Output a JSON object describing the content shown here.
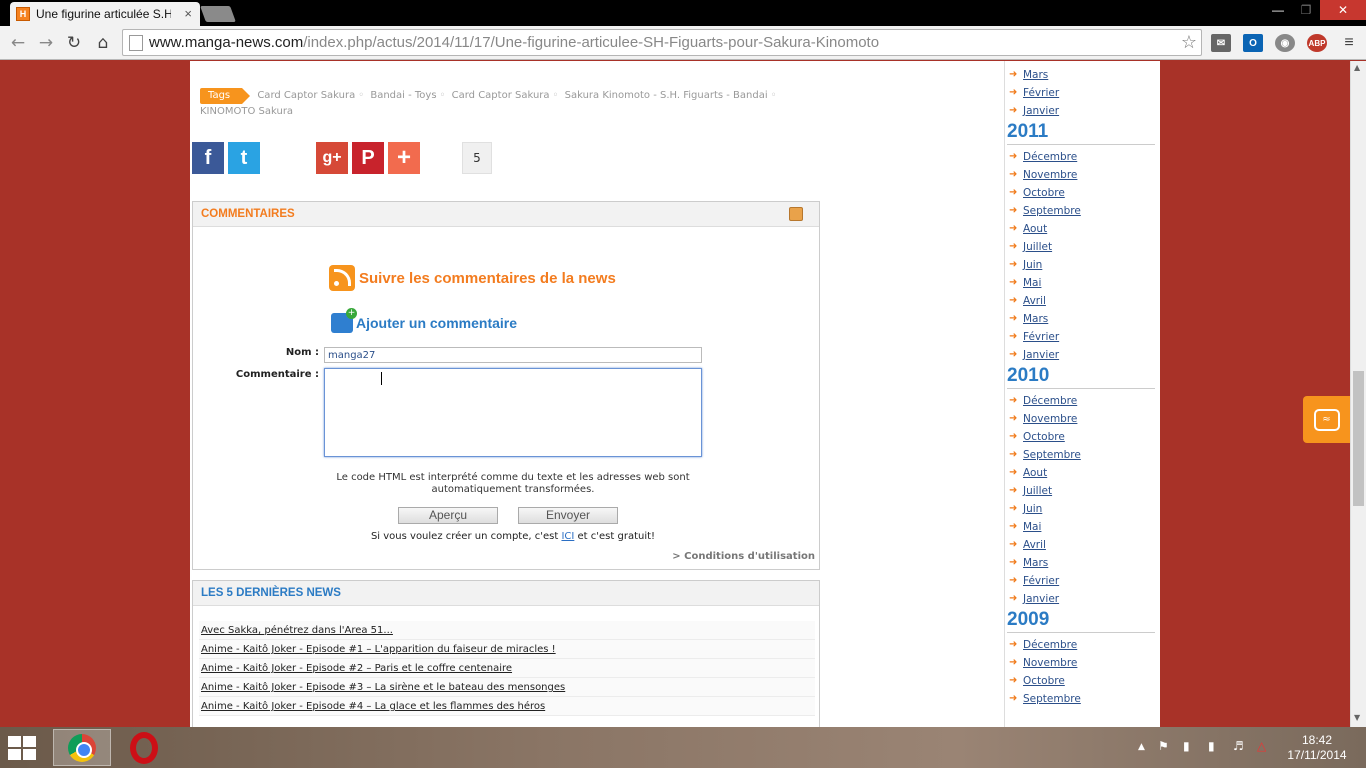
{
  "browser": {
    "tab_title": "Une figurine articulée S.H.",
    "tab_close": "×",
    "url_host": "www.manga-news.com",
    "url_path": "/index.php/actus/2014/11/17/Une-figurine-articulee-SH-Figuarts-pour-Sakura-Kinomoto",
    "favicon_letter": "H",
    "abp_badge": "ABP"
  },
  "tags": {
    "label": "Tags",
    "items": [
      "Card Captor Sakura",
      "Bandai - Toys",
      "Card Captor Sakura",
      "Sakura Kinomoto - S.H. Figuarts - Bandai",
      "KINOMOTO Sakura"
    ]
  },
  "share": {
    "facebook": "f",
    "twitter": "t",
    "count": "5",
    "googleplus": "g+",
    "pinterest": "P",
    "more": "+"
  },
  "comments": {
    "header": "COMMENTAIRES",
    "follow": "Suivre les commentaires de la news",
    "add": "Ajouter un commentaire",
    "name_label": "Nom :",
    "name_value": "manga27",
    "comment_label": "Commentaire :",
    "note": "Le code HTML est interprété comme du texte et les adresses web sont automatiquement transformées.",
    "preview_button": "Aperçu",
    "send_button": "Envoyer",
    "account_prefix": "Si vous voulez créer un compte, c'est",
    "account_link": "ICI",
    "account_suffix": "et c'est gratuit!",
    "terms": "> Conditions d'utilisation"
  },
  "latest_news": {
    "header": "LES 5 DERNIÈRES NEWS",
    "items": [
      "Avec Sakka, pénétrez dans l'Area 51...",
      "Anime - Kaitô Joker - Episode #1 – L'apparition du faiseur de miracles !",
      "Anime - Kaitô Joker - Episode #2 – Paris et le coffre centenaire",
      "Anime - Kaitô Joker - Episode #3 – La sirène et le bateau des mensonges",
      "Anime - Kaitô Joker - Episode #4 – La glace et les flammes des héros"
    ]
  },
  "archives": {
    "top_months": [
      "Mars",
      "Février",
      "Janvier"
    ],
    "y2011": "2011",
    "y2011_months": [
      "Décembre",
      "Novembre",
      "Octobre",
      "Septembre",
      "Aout",
      "Juillet",
      "Juin",
      "Mai",
      "Avril",
      "Mars",
      "Février",
      "Janvier"
    ],
    "y2010": "2010",
    "y2010_months": [
      "Décembre",
      "Novembre",
      "Octobre",
      "Septembre",
      "Aout",
      "Juillet",
      "Juin",
      "Mai",
      "Avril",
      "Mars",
      "Février",
      "Janvier"
    ],
    "y2009": "2009",
    "y2009_months": [
      "Décembre",
      "Novembre",
      "Octobre",
      "Septembre"
    ]
  },
  "taskbar": {
    "time": "18:42",
    "date": "17/11/2014"
  },
  "colors": {
    "page_background": "#a83228",
    "accent_orange": "#f37c1f",
    "accent_blue": "#2b7bc4"
  }
}
